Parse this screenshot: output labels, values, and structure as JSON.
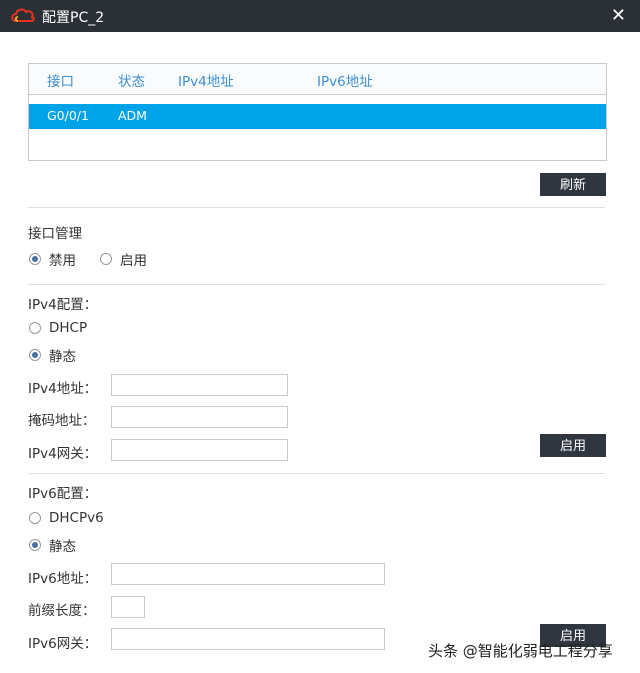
{
  "window": {
    "title": "配置PC_2",
    "close_label": "✕"
  },
  "table": {
    "headers": [
      "接口",
      "状态",
      "IPv4地址",
      "IPv6地址"
    ],
    "rows": [
      {
        "iface": "G0/0/1",
        "state": "ADM",
        "ipv4": "",
        "ipv6": ""
      }
    ]
  },
  "refresh_label": "刷新",
  "iface_mgmt": {
    "title": "接口管理",
    "disable": "禁用",
    "enable": "启用",
    "selected": "disable"
  },
  "ipv4": {
    "title": "IPv4配置：",
    "dhcp": "DHCP",
    "static": "静态",
    "selected": "static",
    "addr_label": "IPv4地址：",
    "mask_label": "掩码地址：",
    "gw_label": "IPv4网关：",
    "addr_value": "",
    "mask_value": "",
    "gw_value": "",
    "apply_label": "启用"
  },
  "ipv6": {
    "title": "IPv6配置：",
    "dhcp": "DHCPv6",
    "static": "静态",
    "selected": "static",
    "addr_label": "IPv6地址：",
    "prefix_label": "前缀长度：",
    "gw_label": "IPv6网关：",
    "addr_value": "",
    "prefix_value": "",
    "gw_value": "",
    "apply_label": "启用"
  },
  "watermark": "头条 @智能化弱电工程分享",
  "colors": {
    "titlebar": "#2b2f36",
    "selected_row": "#00a3e8",
    "header_text": "#3b8fd1",
    "button": "#2f3640"
  }
}
